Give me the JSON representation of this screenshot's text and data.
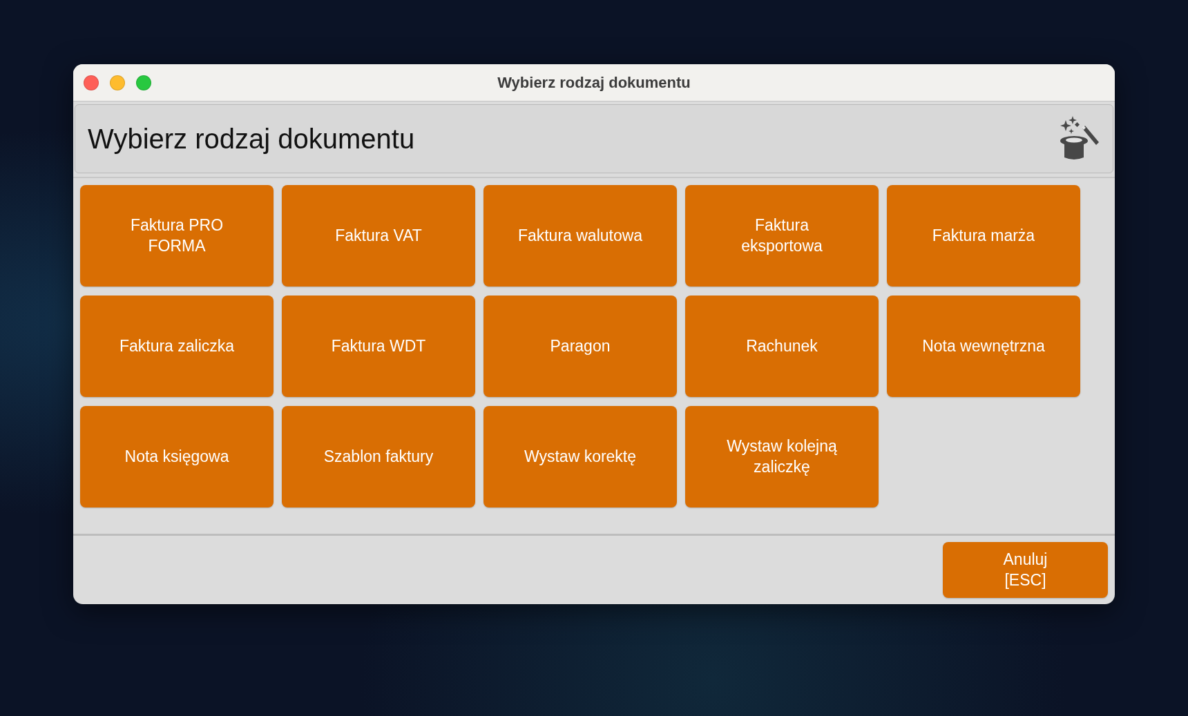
{
  "window": {
    "title": "Wybierz rodzaj dokumentu"
  },
  "header": {
    "title": "Wybierz rodzaj dokumentu"
  },
  "document_types": [
    {
      "label": "Faktura PRO FORMA"
    },
    {
      "label": "Faktura VAT"
    },
    {
      "label": "Faktura walutowa"
    },
    {
      "label": "Faktura eksportowa"
    },
    {
      "label": "Faktura marża"
    },
    {
      "label": "Faktura zaliczka"
    },
    {
      "label": "Faktura WDT"
    },
    {
      "label": "Paragon"
    },
    {
      "label": "Rachunek"
    },
    {
      "label": "Nota wewnętrzna"
    },
    {
      "label": "Nota księgowa"
    },
    {
      "label": "Szablon faktury"
    },
    {
      "label": "Wystaw korektę"
    },
    {
      "label": "Wystaw kolejną zaliczkę"
    }
  ],
  "footer": {
    "cancel_button": "Anuluj\n[ESC]"
  }
}
